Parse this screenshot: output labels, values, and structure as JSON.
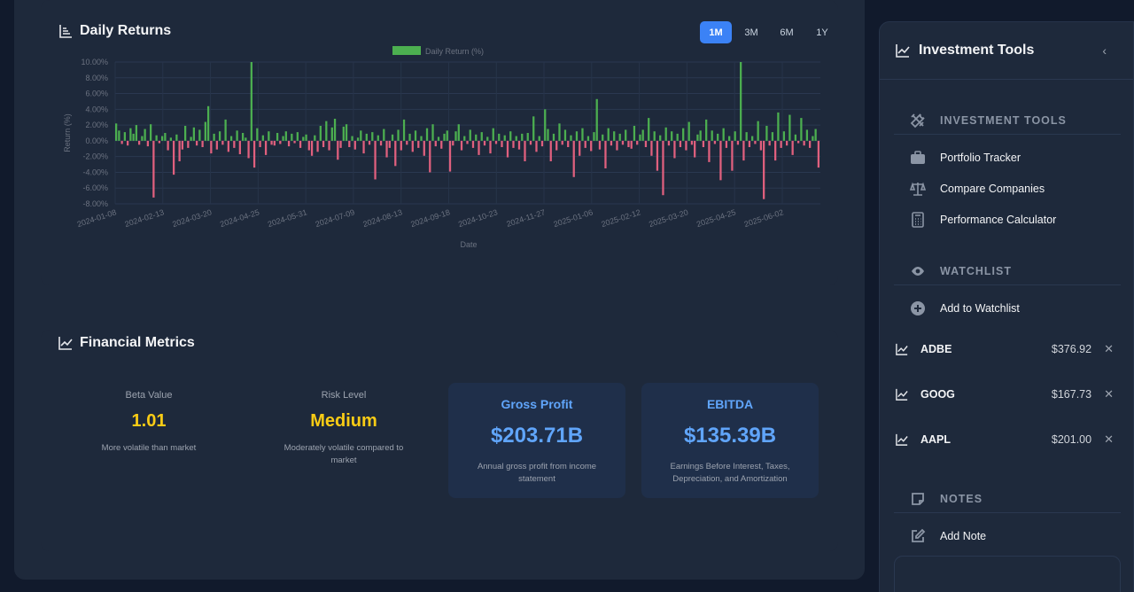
{
  "returns": {
    "title": "Daily Returns",
    "ranges": [
      "1M",
      "3M",
      "6M",
      "1Y"
    ],
    "active_range": "1M"
  },
  "chart_data": {
    "type": "bar",
    "title": "",
    "legend": "Daily Return (%)",
    "legend_placement": "top",
    "xlabel": "Date",
    "ylabel": "Return (%)",
    "ylim": [
      -8,
      10
    ],
    "yticks": [
      "10.00%",
      "8.00%",
      "6.00%",
      "4.00%",
      "2.00%",
      "0.00%",
      "-2.00%",
      "-4.00%",
      "-6.00%",
      "-8.00%"
    ],
    "xticks": [
      "2024-01-08",
      "2024-02-13",
      "2024-03-20",
      "2024-04-25",
      "2024-05-31",
      "2024-07-09",
      "2024-08-13",
      "2024-09-18",
      "2024-10-23",
      "2024-11-27",
      "2025-01-06",
      "2025-02-12",
      "2025-03-20",
      "2025-04-25",
      "2025-06-02"
    ],
    "grid": true,
    "positive_color": "#4caf50",
    "negative_color": "#e0607e",
    "values": [
      2.2,
      1.3,
      -0.4,
      1.1,
      -0.6,
      1.6,
      0.9,
      2.0,
      -0.5,
      0.6,
      1.5,
      -0.7,
      2.1,
      -7.2,
      0.7,
      -0.3,
      0.6,
      1.0,
      -1.2,
      0.4,
      -4.3,
      0.8,
      -2.6,
      -1.1,
      1.9,
      -0.9,
      0.5,
      1.7,
      -0.6,
      1.4,
      -0.8,
      2.4,
      4.4,
      -1.6,
      0.9,
      -1.1,
      1.2,
      -0.5,
      2.7,
      -1.4,
      0.6,
      -0.9,
      1.3,
      -1.7,
      1.0,
      0.4,
      -2.2,
      10.0,
      -3.4,
      1.6,
      -0.8,
      0.7,
      -1.8,
      1.2,
      -0.5,
      -0.6,
      1.0,
      -0.4,
      0.6,
      1.2,
      -0.7,
      0.9,
      -0.3,
      1.1,
      -0.9,
      0.5,
      0.8,
      -1.2,
      -1.9,
      0.7,
      -1.4,
      1.9,
      -0.8,
      2.5,
      -1.2,
      1.7,
      2.8,
      -2.4,
      -0.9,
      1.8,
      2.1,
      -0.8,
      0.6,
      -1.1,
      0.4,
      1.3,
      -1.6,
      0.9,
      -0.5,
      1.1,
      -4.9,
      0.7,
      -0.6,
      1.5,
      -2.1,
      -0.9,
      0.8,
      -3.2,
      1.4,
      -1.2,
      2.7,
      -0.5,
      0.9,
      -1.4,
      1.3,
      -0.9,
      0.6,
      -1.9,
      1.6,
      -4.0,
      2.1,
      -0.7,
      0.5,
      -1.0,
      0.9,
      1.3,
      -3.9,
      -0.6,
      1.2,
      2.1,
      -1.2,
      0.6,
      -0.4,
      1.4,
      -0.9,
      0.8,
      -1.8,
      1.1,
      -0.6,
      0.5,
      -1.6,
      1.6,
      -0.4,
      0.9,
      -0.8,
      0.7,
      -2.1,
      1.2,
      -0.9,
      0.6,
      -1.1,
      0.9,
      -2.6,
      1.0,
      -0.5,
      3.1,
      -1.4,
      0.6,
      -0.7,
      4.0,
      1.5,
      -2.6,
      0.9,
      -1.2,
      2.2,
      -0.5,
      1.4,
      -0.8,
      0.7,
      -4.6,
      1.2,
      -1.9,
      1.6,
      -0.9,
      0.6,
      -1.3,
      1.1,
      5.3,
      -1.1,
      0.8,
      -3.5,
      1.6,
      -0.6,
      1.2,
      -1.2,
      0.9,
      -0.5,
      1.4,
      -0.8,
      -1.0,
      1.9,
      -0.5,
      0.8,
      1.4,
      -0.8,
      2.9,
      -1.9,
      1.2,
      -3.8,
      0.7,
      -6.9,
      1.7,
      -0.6,
      1.2,
      -2.2,
      0.9,
      -0.8,
      1.6,
      -1.2,
      2.4,
      -0.5,
      -2.1,
      0.8,
      1.3,
      -0.8,
      2.7,
      -2.7,
      1.3,
      -0.4,
      0.9,
      -5.0,
      1.6,
      -0.9,
      0.6,
      -3.8,
      1.2,
      -0.5,
      10.0,
      -2.5,
      1.1,
      -0.8,
      0.6,
      -0.4,
      2.5,
      -1.2,
      -7.4,
      1.9,
      -0.6,
      1.1,
      -2.5,
      3.6,
      -0.9,
      1.2,
      -0.6,
      3.3,
      -1.8,
      0.8,
      -0.3,
      2.9,
      -0.6,
      1.4,
      -0.9,
      0.6,
      1.5,
      -3.4
    ],
    "tooltip": null
  },
  "metrics": {
    "title": "Financial Metrics",
    "items": [
      {
        "label": "Beta Value",
        "value": "1.01",
        "desc": "More volatile than market"
      },
      {
        "label": "Risk Level",
        "value": "Medium",
        "desc": "Moderately volatile compared to market"
      },
      {
        "label": "Gross Profit",
        "value": "$203.71B",
        "desc": "Annual gross profit from income statement"
      },
      {
        "label": "EBITDA",
        "value": "$135.39B",
        "desc": "Earnings Before Interest, Taxes, Depreciation, and Amortization"
      }
    ]
  },
  "sidebar": {
    "title": "Investment Tools",
    "collapse_icon": "chevron-left-icon",
    "tools_section": "INVESTMENT TOOLS",
    "tools": [
      {
        "label": "Portfolio Tracker",
        "icon": "briefcase-icon"
      },
      {
        "label": "Compare Companies",
        "icon": "scale-icon"
      },
      {
        "label": "Performance Calculator",
        "icon": "calculator-icon"
      }
    ],
    "watchlist_section": "WATCHLIST",
    "add_watchlist": "Add to Watchlist",
    "watchlist": [
      {
        "symbol": "ADBE",
        "price": "$376.92",
        "remove": "✕"
      },
      {
        "symbol": "GOOG",
        "price": "$167.73",
        "remove": "✕"
      },
      {
        "symbol": "AAPL",
        "price": "$201.00",
        "remove": "✕"
      }
    ],
    "notes_section": "NOTES",
    "add_note": "Add Note"
  }
}
